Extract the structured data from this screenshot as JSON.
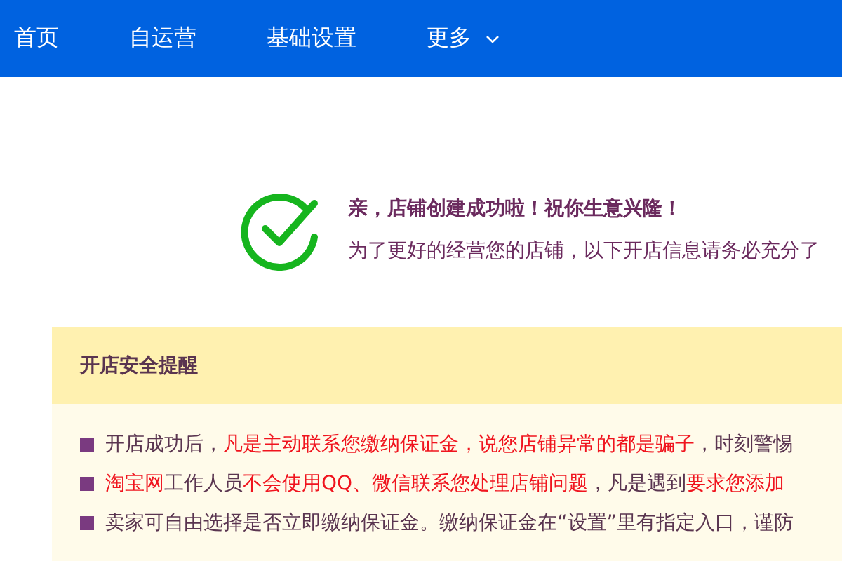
{
  "nav": {
    "items": [
      {
        "label": "首页",
        "dropdown": false
      },
      {
        "label": "自运营",
        "dropdown": false
      },
      {
        "label": "基础设置",
        "dropdown": false
      },
      {
        "label": "更多",
        "dropdown": true
      }
    ]
  },
  "success": {
    "title": "亲，店铺创建成功啦！祝你生意兴隆！",
    "subtitle": "为了更好的经营您的店铺，以下开店信息请务必充分了"
  },
  "notice": {
    "title": "开店安全提醒",
    "items": [
      [
        {
          "text": "开店成功后，",
          "highlight": false
        },
        {
          "text": "凡是主动联系您缴纳保证金，说您店铺异常的都是骗子",
          "highlight": true
        },
        {
          "text": "，时刻警惕",
          "highlight": false
        }
      ],
      [
        {
          "text": "淘宝网",
          "highlight": true
        },
        {
          "text": "工作人员",
          "highlight": false
        },
        {
          "text": "不会使用QQ、微信联系您处理店铺问题",
          "highlight": true
        },
        {
          "text": "，凡是遇到",
          "highlight": false
        },
        {
          "text": "要求您添加",
          "highlight": true
        }
      ],
      [
        {
          "text": "卖家可自由选择是否立即缴纳保证金。缴纳保证金在“设置”里有指定入口，谨防",
          "highlight": false
        }
      ]
    ]
  }
}
